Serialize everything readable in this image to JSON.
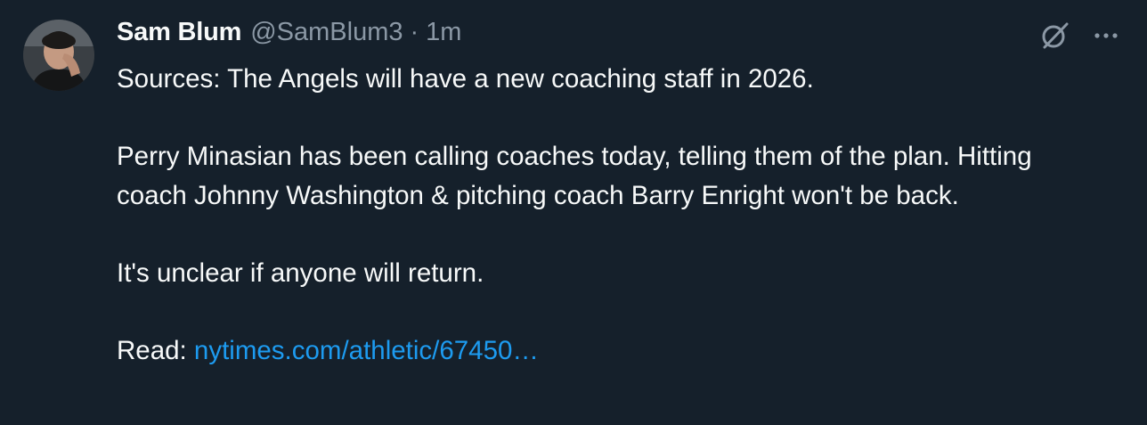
{
  "author": {
    "name": "Sam Blum",
    "handle": "@SamBlum3",
    "separator": "·",
    "time": "1m",
    "avatar_icon": "avatar"
  },
  "tweet": {
    "line1": "Sources: The Angels will have a new coaching staff in 2026.",
    "line2": "Perry Minasian has been calling coaches today, telling them of the plan. Hitting coach Johnny Washington & pitching coach Barry Enright won't be back.",
    "line3": "It's unclear if anyone will return.",
    "read_label": "Read: ",
    "link_text": "nytimes.com/athletic/67450…"
  },
  "actions": {
    "grok_icon": "grok-icon",
    "more_icon": "more-icon"
  },
  "colors": {
    "background": "#15202b",
    "text": "#f7f9f9",
    "secondary": "#8b98a5",
    "link": "#1d9bf0"
  }
}
